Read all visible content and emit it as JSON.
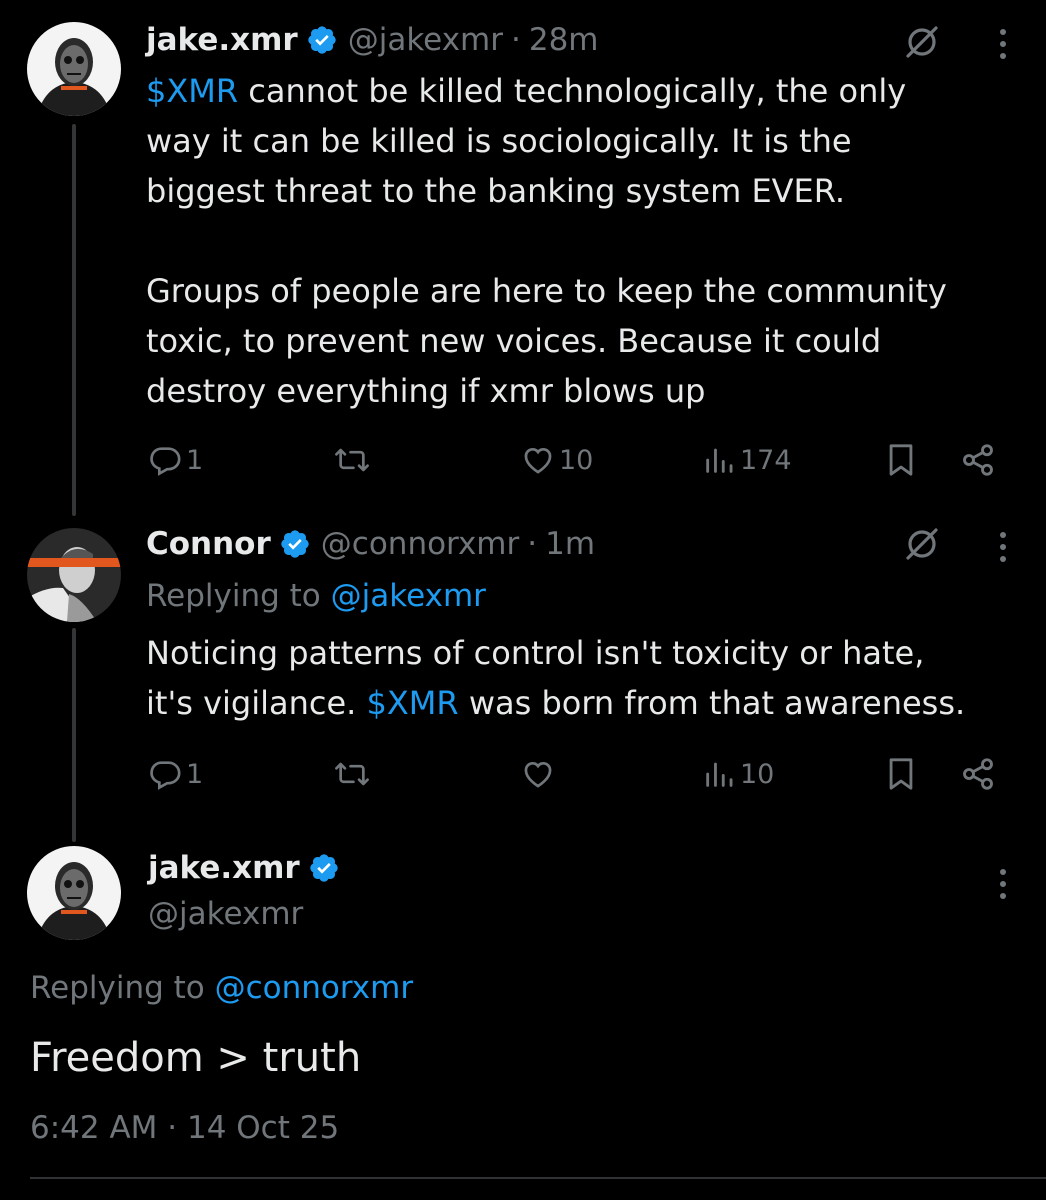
{
  "colors": {
    "background": "#000000",
    "text": "#e7e9ea",
    "muted": "#71767b",
    "link": "#1d9bf0",
    "verified_badge": "#1d9bf0"
  },
  "tweet1": {
    "name": "jake.xmr",
    "handle": "@jakexmr",
    "sep": "·",
    "time": "28m",
    "text_cashtag": "$XMR",
    "text_rest": " cannot be killed technologically, the only\nway it can be killed is sociologically. It is the\nbiggest threat to the banking system EVER.\n\nGroups of people are here to keep the community\ntoxic, to prevent new voices. Because it could\ndestroy everything if xmr blows up",
    "replies": "1",
    "likes": "10",
    "views": "174",
    "icons": [
      "verified-icon",
      "mute-icon",
      "more-icon",
      "reply-icon",
      "retweet-icon",
      "like-icon",
      "views-icon",
      "bookmark-icon",
      "share-icon"
    ]
  },
  "tweet2": {
    "name": "Connor",
    "handle": "@connorxmr",
    "sep": "·",
    "time": "1m",
    "replying_prefix": "Replying to ",
    "replying_handle": "@jakexmr",
    "text_line1": "Noticing patterns of control isn't toxicity or hate,",
    "text_line2_pre": "it's vigilance. ",
    "text_cashtag": "$XMR",
    "text_line2_post": " was born from that awareness.",
    "replies": "1",
    "views": "10"
  },
  "main": {
    "name": "jake.xmr",
    "handle": "@jakexmr",
    "replying_prefix": "Replying to ",
    "replying_handle": "@connorxmr",
    "text": "Freedom > truth",
    "timestamp": "6:42 AM · 14 Oct 25"
  }
}
